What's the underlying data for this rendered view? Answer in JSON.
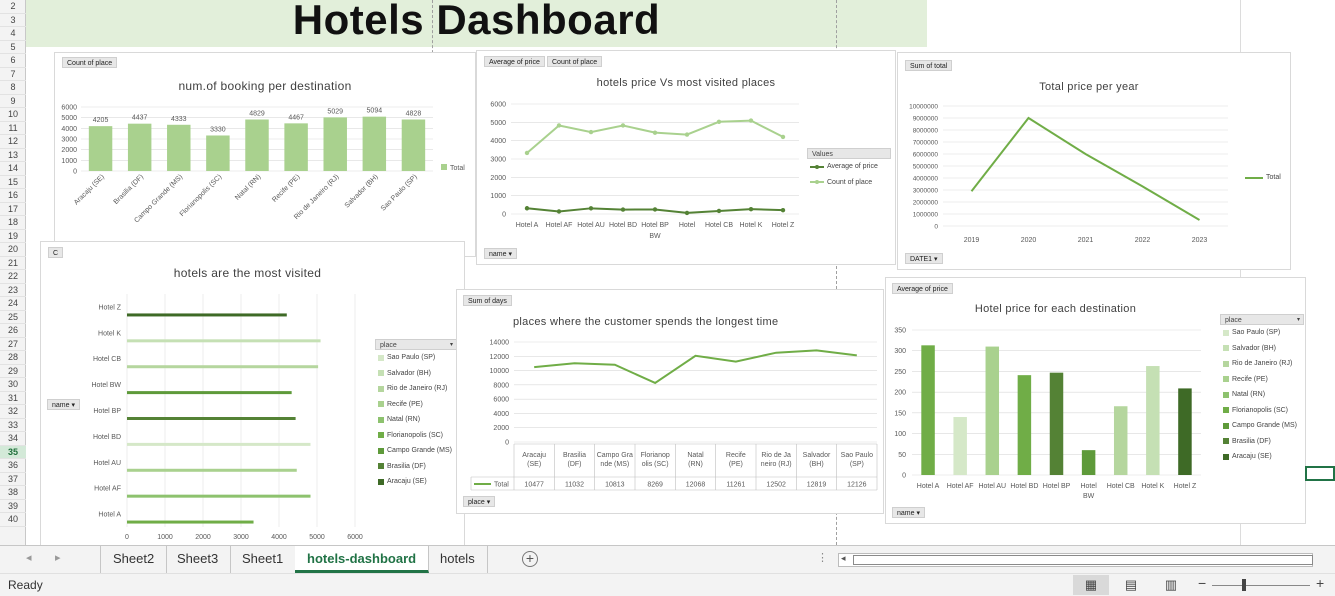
{
  "dashboard_title": "Hotels Dashboard",
  "row_numbers": [
    "2",
    "3",
    "4",
    "5",
    "6",
    "7",
    "8",
    "9",
    "10",
    "11",
    "12",
    "13",
    "14",
    "15",
    "16",
    "17",
    "18",
    "19",
    "20",
    "21",
    "22",
    "23",
    "24",
    "25",
    "26",
    "27",
    "28",
    "29",
    "30",
    "31",
    "32",
    "33",
    "34",
    "35",
    "36",
    "37",
    "38",
    "39",
    "40"
  ],
  "charts": {
    "bookings": {
      "field_button": "Count of place",
      "filter_button": "place",
      "chart_data": {
        "type": "bar",
        "title": "num.of booking per destination",
        "categories": [
          "Aracaju (SE)",
          "Brasilia (DF)",
          "Campo Grande (MS)",
          "Florianopolis (SC)",
          "Natal (RN)",
          "Recife (PE)",
          "Rio de Janeiro (RJ)",
          "Salvador (BH)",
          "Sao Paulo (SP)"
        ],
        "values": [
          4205,
          4437,
          4333,
          3330,
          4829,
          4467,
          5029,
          5094,
          4828
        ],
        "data_labels": [
          "4205",
          "4437",
          "4333",
          "3330",
          "4829",
          "4467",
          "5029",
          "5094",
          "4828"
        ],
        "ylim": [
          0,
          6000
        ],
        "yticks": [
          "0",
          "1000",
          "2000",
          "3000",
          "4000",
          "5000",
          "6000"
        ],
        "legend": [
          "Total"
        ],
        "color": "#a9d18e"
      }
    },
    "price_vs_visits": {
      "field_buttons": [
        "Average of price",
        "Count of place"
      ],
      "filter_button": "name",
      "legend_title": "Values",
      "chart_data": {
        "type": "line",
        "title": "hotels price Vs most visited places",
        "xlabel": "BW",
        "categories": [
          "Hotel A",
          "Hotel AF",
          "Hotel AU",
          "Hotel BD",
          "Hotel BP",
          "Hotel",
          "Hotel CB",
          "Hotel K",
          "Hotel Z"
        ],
        "series": [
          {
            "name": "Average of price",
            "values": [
              313,
              140,
              310,
              241,
              247,
              60,
              166,
              263,
              209
            ],
            "color": "#548235"
          },
          {
            "name": "Count of place",
            "values": [
              3330,
              4829,
              4467,
              4828,
              4437,
              4333,
              5029,
              5094,
              4205
            ],
            "color": "#a9d18e"
          }
        ],
        "ylim": [
          0,
          6000
        ],
        "yticks": [
          "0",
          "1000",
          "2000",
          "3000",
          "4000",
          "5000",
          "6000"
        ]
      }
    },
    "total_per_year": {
      "field_button": "Sum of total",
      "filter_button": "DATE1",
      "chart_data": {
        "type": "line",
        "title": "Total price per year",
        "categories": [
          "2019",
          "2020",
          "2021",
          "2022",
          "2023"
        ],
        "values": [
          2900000,
          9000000,
          6000000,
          3300000,
          500000
        ],
        "ylim": [
          0,
          10000000
        ],
        "yticks": [
          "0",
          "1000000",
          "2000000",
          "3000000",
          "4000000",
          "5000000",
          "6000000",
          "7000000",
          "8000000",
          "9000000",
          "10000000"
        ],
        "legend": [
          "Total"
        ],
        "color": "#70ad47"
      }
    },
    "most_visited": {
      "field_button_partial": "C",
      "filter_button": "name",
      "chart_data": {
        "type": "bar",
        "title": "hotels are the most visited",
        "categories": [
          "Hotel Z",
          "Hotel K",
          "Hotel CB",
          "Hotel BW",
          "Hotel BP",
          "Hotel BD",
          "Hotel AU",
          "Hotel AF",
          "Hotel A"
        ],
        "series": [
          {
            "name": "Sao Paulo (SP)",
            "color": "#d5e8c8"
          },
          {
            "name": "Salvador (BH)",
            "color": "#c5e0b4"
          },
          {
            "name": "Rio de Janeiro (RJ)",
            "color": "#b5d69e"
          },
          {
            "name": "Recife (PE)",
            "color": "#a9d18e"
          },
          {
            "name": "Natal (RN)",
            "color": "#8dc26e"
          },
          {
            "name": "Florianopolis (SC)",
            "color": "#70ad47"
          },
          {
            "name": "Campo Grande (MS)",
            "color": "#5e9a3a"
          },
          {
            "name": "Brasilia (DF)",
            "color": "#548235"
          },
          {
            "name": "Aracaju (SE)",
            "color": "#3e6a26"
          }
        ],
        "bars": [
          {
            "category": "Hotel Z",
            "series": "Aracaju (SE)",
            "value": 4205
          },
          {
            "category": "Hotel K",
            "series": "Salvador (BH)",
            "value": 5094
          },
          {
            "category": "Hotel CB",
            "series": "Rio de Janeiro (RJ)",
            "value": 5029
          },
          {
            "category": "Hotel BW",
            "series": "Campo Grande (MS)",
            "value": 4333
          },
          {
            "category": "Hotel BP",
            "series": "Brasilia (DF)",
            "value": 4437
          },
          {
            "category": "Hotel BD",
            "series": "Sao Paulo (SP)",
            "value": 4828
          },
          {
            "category": "Hotel AU",
            "series": "Recife (PE)",
            "value": 4467
          },
          {
            "category": "Hotel AF",
            "series": "Natal (RN)",
            "value": 4829
          },
          {
            "category": "Hotel A",
            "series": "Florianopolis (SC)",
            "value": 3330
          }
        ],
        "xlim": [
          0,
          6000
        ],
        "xticks": [
          "0",
          "1000",
          "2000",
          "3000",
          "4000",
          "5000",
          "6000"
        ],
        "legend_title": "place"
      }
    },
    "longest_time": {
      "field_button": "Sum of days",
      "filter_button": "place",
      "chart_data": {
        "type": "line",
        "title": "places where the customer spends the longest time",
        "categories": [
          "Aracaju (SE)",
          "Brasilia (DF)",
          "Campo Grande (MS)",
          "Florianopolis (SC)",
          "Natal (RN)",
          "Recife (PE)",
          "Rio de Janeiro (RJ)",
          "Salvador (BH)",
          "Sao Paulo (SP)"
        ],
        "values": [
          10477,
          11032,
          10813,
          8269,
          12068,
          11261,
          12502,
          12819,
          12126
        ],
        "ylim": [
          0,
          14000
        ],
        "yticks": [
          "0",
          "2000",
          "4000",
          "6000",
          "8000",
          "10000",
          "12000",
          "14000"
        ],
        "table_label": "Total",
        "table_values": [
          "10477",
          "11032",
          "10813",
          "8269",
          "12068",
          "11261",
          "12502",
          "12819",
          "12126"
        ],
        "color": "#70ad47"
      }
    },
    "price_per_destination": {
      "field_button": "Average of price",
      "filter_button": "name",
      "chart_data": {
        "type": "bar",
        "title": "Hotel price for each destination",
        "xlabel": "BW",
        "categories": [
          "Hotel A",
          "Hotel AF",
          "Hotel AU",
          "Hotel BD",
          "Hotel BP",
          "Hotel",
          "Hotel CB",
          "Hotel K",
          "Hotel Z"
        ],
        "values": [
          313,
          140,
          310,
          241,
          247,
          60,
          166,
          263,
          209
        ],
        "colors": [
          "#70ad47",
          "#d5e8c8",
          "#a9d18e",
          "#70ad47",
          "#548235",
          "#5e9a3a",
          "#b5d69e",
          "#c5e0b4",
          "#3e6a26"
        ],
        "ylim": [
          0,
          350
        ],
        "yticks": [
          "0",
          "50",
          "100",
          "150",
          "200",
          "250",
          "300",
          "350"
        ],
        "legend_title": "place",
        "legend": [
          {
            "name": "Sao Paulo (SP)",
            "color": "#d5e8c8"
          },
          {
            "name": "Salvador (BH)",
            "color": "#c5e0b4"
          },
          {
            "name": "Rio de Janeiro (RJ)",
            "color": "#b5d69e"
          },
          {
            "name": "Recife (PE)",
            "color": "#a9d18e"
          },
          {
            "name": "Natal (RN)",
            "color": "#8dc26e"
          },
          {
            "name": "Florianopolis (SC)",
            "color": "#70ad47"
          },
          {
            "name": "Campo Grande (MS)",
            "color": "#5e9a3a"
          },
          {
            "name": "Brasilia (DF)",
            "color": "#548235"
          },
          {
            "name": "Aracaju (SE)",
            "color": "#3e6a26"
          }
        ]
      }
    }
  },
  "sheet_tabs": [
    "Sheet2",
    "Sheet3",
    "Sheet1",
    "hotels-dashboard",
    "hotels"
  ],
  "active_tab": "hotels-dashboard",
  "status": "Ready",
  "accent": "#217346"
}
